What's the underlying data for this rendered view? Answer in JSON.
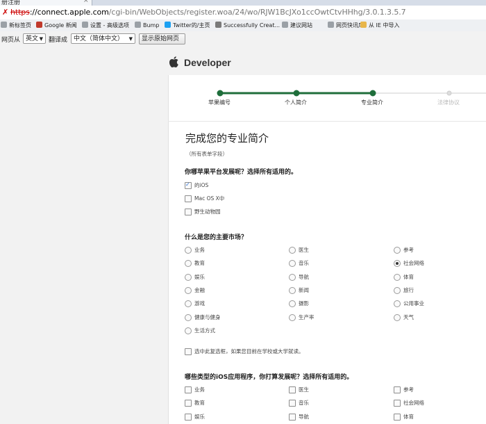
{
  "browser": {
    "tab_title": "册注册",
    "tab_close": "×",
    "url_scheme": "https",
    "url_host": "://connect.apple.com",
    "url_path": "/cgi-bin/WebObjects/register.woa/24/wo/RJW1BcJXo1ccOwtCtvHHhg/3.0.1.3.5.7",
    "ssl_icon": "✗",
    "bookmarks": [
      {
        "label": "新标签页",
        "icon": "new-tab-icon",
        "color": "#9aa0a6"
      },
      {
        "label": "Google 新闻",
        "icon": "google-news-icon",
        "color": "#c0392b"
      },
      {
        "label": "设置 - 高级选项",
        "icon": "settings-page-icon",
        "color": "#9aa0a6"
      },
      {
        "label": "Bump",
        "icon": "bump-icon",
        "color": "#9aa0a6"
      },
      {
        "label": "Twitter的/主页",
        "icon": "twitter-bird-icon",
        "color": "#1da1f2"
      },
      {
        "label": "Successfully Creat...",
        "icon": "bookmark-page-icon",
        "color": "#7a7a7a"
      },
      {
        "label": "建议网站",
        "icon": "suggested-sites-icon",
        "color": "#9aa0a6"
      },
      {
        "label": "网页快讯库",
        "icon": "web-slice-icon",
        "color": "#9aa0a6"
      },
      {
        "label": "从 IE 中导入",
        "icon": "folder-icon",
        "color": "#e8b64a"
      }
    ]
  },
  "translate_bar": {
    "from_label": "网页从",
    "from_lang": "英文",
    "to_label": "翻译成",
    "to_lang": "中文（简体中文）",
    "show_original": "显示原始网页"
  },
  "header": {
    "apple_logo": "apple-logo-icon",
    "title": "Developer"
  },
  "progress": {
    "steps": [
      {
        "label": "苹果编号",
        "done": true
      },
      {
        "label": "个人简介",
        "done": true
      },
      {
        "label": "专业简介",
        "done": true
      },
      {
        "label": "法律协议",
        "done": false
      }
    ],
    "done_color": "#1f6e3b",
    "todo_color": "#cccccc"
  },
  "form": {
    "title": "完成您的专业简介",
    "required_note": "（所有表单字段）",
    "q1": {
      "heading": "你哪苹果平台发展呢？选择所有适用的。",
      "options": [
        {
          "label": "的iOS",
          "checked": true
        },
        {
          "label": "Mac OS X中",
          "checked": false
        },
        {
          "label": "野生动物园",
          "checked": false
        }
      ]
    },
    "q2": {
      "heading": "什么是您的主要市场？",
      "options": [
        {
          "label": "业务",
          "selected": false
        },
        {
          "label": "医生",
          "selected": false
        },
        {
          "label": "参考",
          "selected": false
        },
        {
          "label": "教育",
          "selected": false
        },
        {
          "label": "音乐",
          "selected": false
        },
        {
          "label": "社会网络",
          "selected": true
        },
        {
          "label": "娱乐",
          "selected": false
        },
        {
          "label": "导航",
          "selected": false
        },
        {
          "label": "体育",
          "selected": false
        },
        {
          "label": "金融",
          "selected": false
        },
        {
          "label": "新闻",
          "selected": false
        },
        {
          "label": "旅行",
          "selected": false
        },
        {
          "label": "游戏",
          "selected": false
        },
        {
          "label": "摄影",
          "selected": false
        },
        {
          "label": "公用事业",
          "selected": false
        },
        {
          "label": "健康与健身",
          "selected": false
        },
        {
          "label": "生产率",
          "selected": false
        },
        {
          "label": "天气",
          "selected": false
        },
        {
          "label": "生活方式",
          "selected": false
        }
      ],
      "student_option": "选中此复选框，如果您目前在学校或大学就读。"
    },
    "q3": {
      "heading": "哪些类型的iOS应用程序，你打算发展呢？选择所有适用的。",
      "options": [
        {
          "label": "业务",
          "checked": false
        },
        {
          "label": "医生",
          "checked": false
        },
        {
          "label": "参考",
          "checked": false
        },
        {
          "label": "教育",
          "checked": false
        },
        {
          "label": "音乐",
          "checked": false
        },
        {
          "label": "社会网络",
          "checked": false
        },
        {
          "label": "娱乐",
          "checked": false
        },
        {
          "label": "导航",
          "checked": false
        },
        {
          "label": "体育",
          "checked": false
        }
      ]
    }
  }
}
